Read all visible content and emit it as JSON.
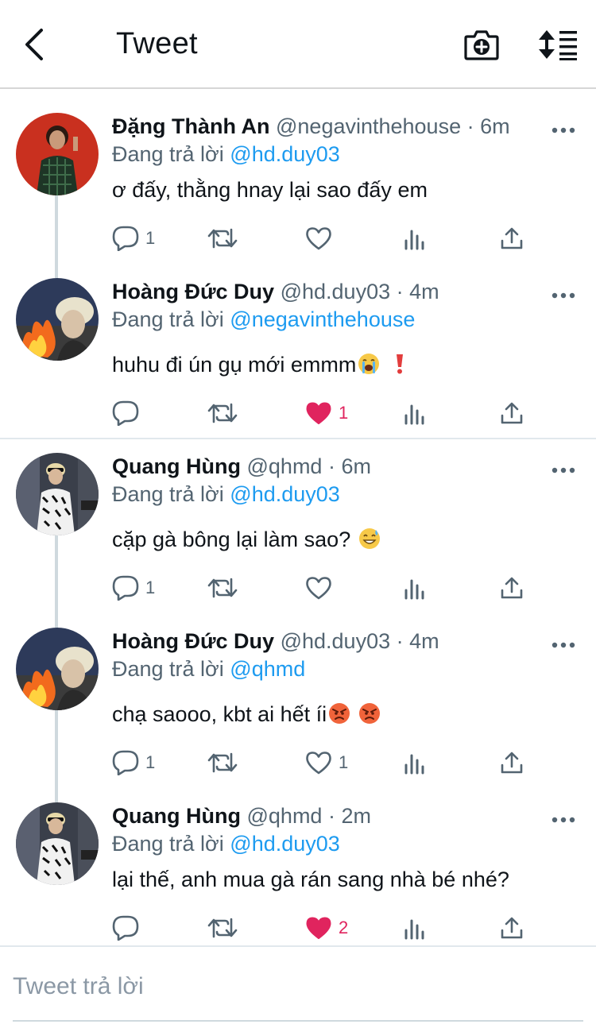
{
  "header": {
    "title": "Tweet",
    "back_icon": "chevron-left-icon",
    "camera_icon": "camera-plus-icon",
    "sort_icon": "sort-icon"
  },
  "colors": {
    "mention": "#1d9bf0",
    "muted": "#536471",
    "like_active": "#e0245e",
    "text": "#0f1419"
  },
  "tweets": [
    {
      "name": "Đặng Thành An",
      "handle": "@negavinthehouse",
      "dot": "·",
      "time": "6m",
      "replying_label": "Đang trả lời",
      "replying_to": "@hd.duy03",
      "text": "ơ đấy, thằng hnay lại sao đấy em",
      "reply_count": "1",
      "retweet_count": "",
      "like_count": "",
      "liked": false
    },
    {
      "name": "Hoàng Đức Duy",
      "handle": "@hd.duy03",
      "dot": "·",
      "time": "4m",
      "replying_label": "Đang trả lời",
      "replying_to": "@negavinthehouse",
      "text": "huhu đi ún gụ mới emmm",
      "emojis": [
        "😭",
        "❗"
      ],
      "reply_count": "",
      "retweet_count": "",
      "like_count": "1",
      "liked": true
    },
    {
      "name": "Quang Hùng",
      "handle": "@qhmd",
      "dot": "·",
      "time": "6m",
      "replying_label": "Đang trả lời",
      "replying_to": "@hd.duy03",
      "text": "cặp gà bông lại làm sao?",
      "emojis": [
        "😅"
      ],
      "reply_count": "1",
      "retweet_count": "",
      "like_count": "",
      "liked": false
    },
    {
      "name": "Hoàng Đức Duy",
      "handle": "@hd.duy03",
      "dot": "·",
      "time": "4m",
      "replying_label": "Đang trả lời",
      "replying_to": "@qhmd",
      "text": "chạ saooo, kbt ai hết íi",
      "emojis": [
        "😡",
        "😡"
      ],
      "reply_count": "1",
      "retweet_count": "",
      "like_count": "1",
      "liked": false
    },
    {
      "name": "Quang Hùng",
      "handle": "@qhmd",
      "dot": "·",
      "time": "2m",
      "replying_label": "Đang trả lời",
      "replying_to": "@hd.duy03",
      "text": "lại thế, anh mua gà rán sang nhà bé nhé?",
      "reply_count": "",
      "retweet_count": "",
      "like_count": "2",
      "liked": true
    }
  ],
  "composer": {
    "placeholder": "Tweet trả lời"
  }
}
